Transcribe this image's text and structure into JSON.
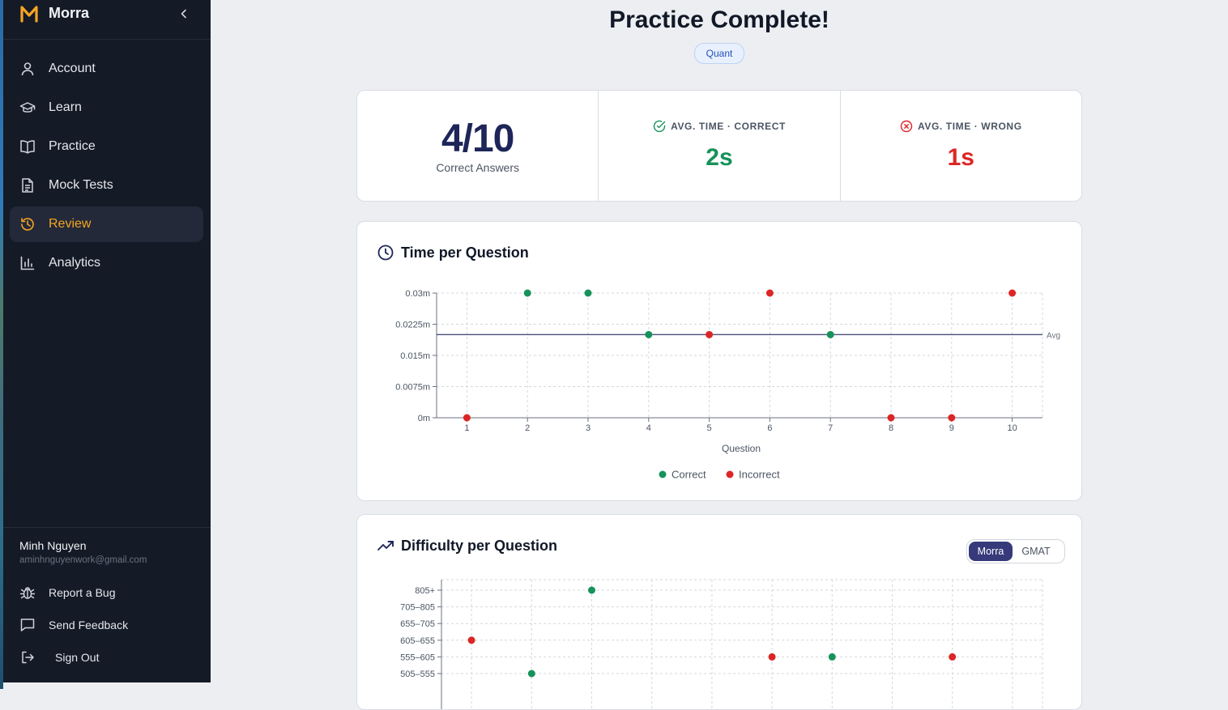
{
  "app": {
    "name": "Morra"
  },
  "sidebar": {
    "items": [
      {
        "label": "Account",
        "icon": "user-icon"
      },
      {
        "label": "Learn",
        "icon": "graduation-cap-icon"
      },
      {
        "label": "Practice",
        "icon": "book-open-icon"
      },
      {
        "label": "Mock Tests",
        "icon": "document-icon"
      },
      {
        "label": "Review",
        "icon": "history-icon",
        "active": true
      },
      {
        "label": "Analytics",
        "icon": "bar-chart-icon"
      }
    ],
    "user": {
      "name": "Minh Nguyen",
      "email": "aminhnguyenwork@gmail.com"
    },
    "footer": [
      {
        "label": "Report a Bug",
        "icon": "bug-icon"
      },
      {
        "label": "Send Feedback",
        "icon": "message-icon"
      },
      {
        "label": "Sign Out",
        "icon": "sign-out-icon"
      }
    ]
  },
  "header": {
    "title": "Practice Complete!",
    "badge": "Quant"
  },
  "stats": {
    "score": "4/10",
    "score_label": "Correct Answers",
    "avg_correct_label": "AVG. TIME · CORRECT",
    "avg_correct_value": "2s",
    "avg_wrong_label": "AVG. TIME · WRONG",
    "avg_wrong_value": "1s"
  },
  "colors": {
    "correct": "#16925a",
    "incorrect": "#dc2626",
    "accent": "#f5a524",
    "navy": "#1e2559"
  },
  "time_chart": {
    "title": "Time per Question",
    "xlabel": "Question",
    "avg_label": "Avg",
    "legend": {
      "correct": "Correct",
      "incorrect": "Incorrect"
    }
  },
  "difficulty_chart": {
    "title": "Difficulty per Question",
    "toggle": {
      "options": [
        "Morra",
        "GMAT"
      ],
      "selected": "Morra"
    }
  },
  "chart_data": [
    {
      "type": "scatter",
      "title": "Time per Question",
      "xlabel": "Question",
      "ylabel": "",
      "x": [
        1,
        2,
        3,
        4,
        5,
        6,
        7,
        8,
        9,
        10
      ],
      "y": [
        0,
        0.03,
        0.03,
        0.02,
        0.02,
        0.03,
        0.02,
        0,
        0,
        0.03
      ],
      "status": [
        "incorrect",
        "correct",
        "correct",
        "correct",
        "incorrect",
        "incorrect",
        "correct",
        "incorrect",
        "incorrect",
        "incorrect"
      ],
      "y_ticks": [
        "0m",
        "0.0075m",
        "0.015m",
        "0.0225m",
        "0.03m"
      ],
      "ylim": [
        0,
        0.03
      ],
      "avg": 0.02,
      "grid": true,
      "legend_position": "bottom"
    },
    {
      "type": "scatter",
      "title": "Difficulty per Question",
      "x": [
        1,
        2,
        3,
        6,
        7,
        9
      ],
      "y": [
        "605–655",
        "505–555",
        "805+",
        "555–605",
        "555–605",
        "555–605"
      ],
      "status": [
        "incorrect",
        "correct",
        "correct",
        "incorrect",
        "correct",
        "incorrect"
      ],
      "y_categories": [
        "505–555",
        "555–605",
        "605–655",
        "655–705",
        "705–805",
        "805+"
      ],
      "grid": true
    }
  ]
}
